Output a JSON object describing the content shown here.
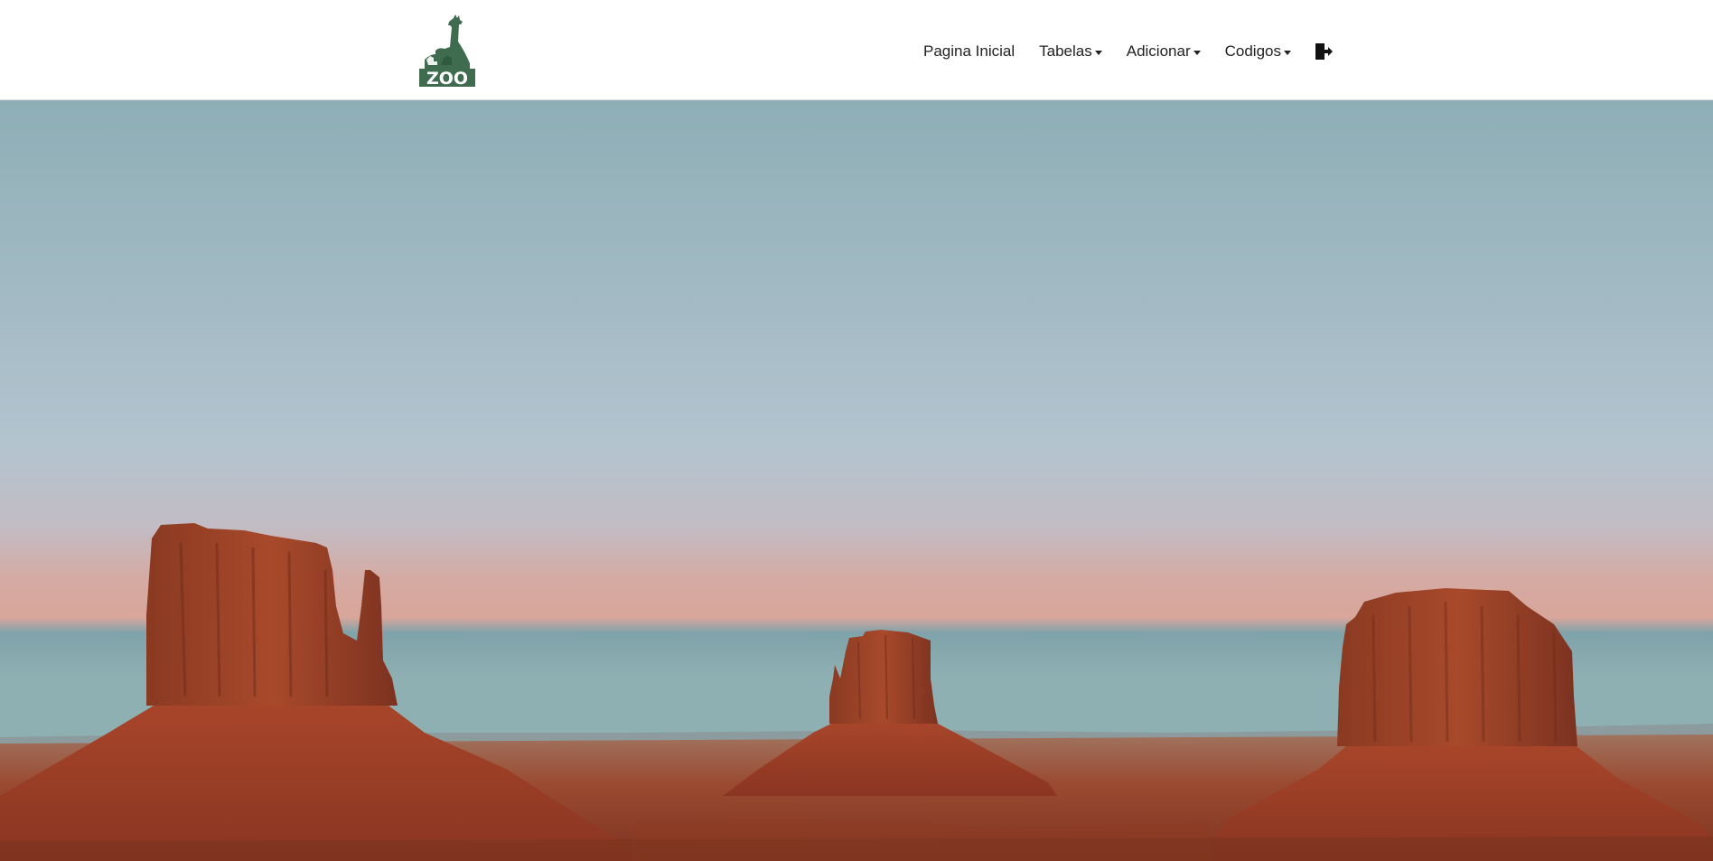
{
  "brand": {
    "logo_icon": "zoo-giraffe-logo",
    "logo_text": "ZOO",
    "logo_color": "#3f6b4f"
  },
  "nav": {
    "home_label": "Pagina Inicial",
    "tables_label": "Tabelas",
    "add_label": "Adicionar",
    "codes_label": "Codigos",
    "logout_icon": "sign-out-icon"
  },
  "hero": {
    "image": "monument-valley-buttes-at-dusk",
    "sky_top": "#8eaeb6",
    "sky_mid": "#b1c3cd",
    "horizon_pink": "#d9a79a",
    "rock_color": "#a4452a"
  }
}
